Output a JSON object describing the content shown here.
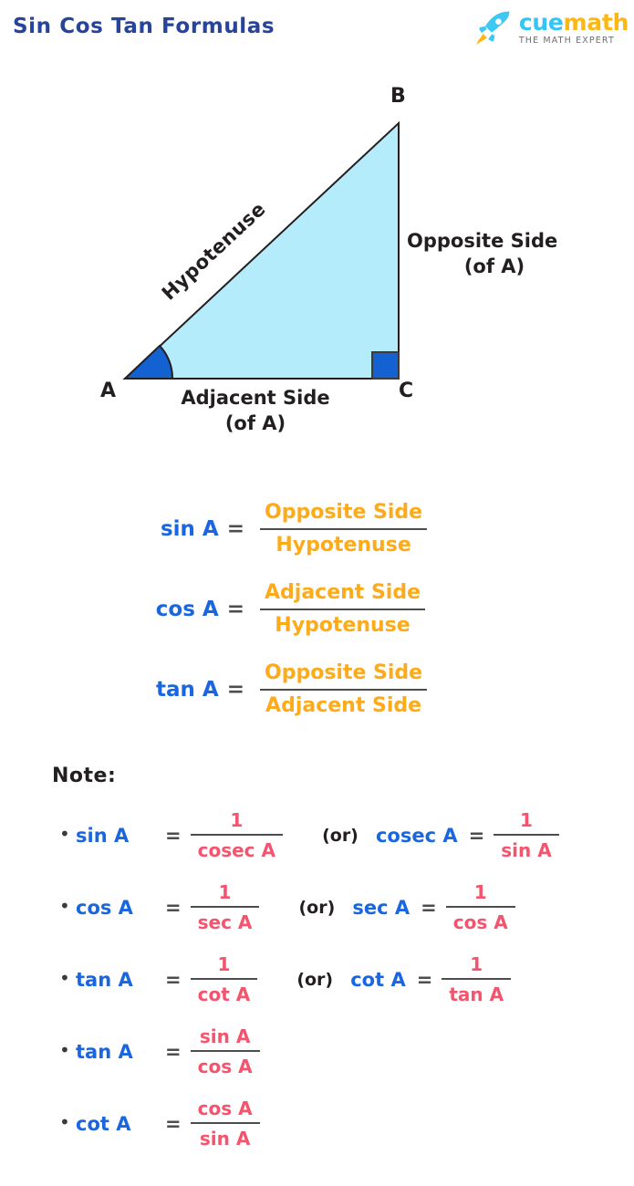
{
  "header": {
    "title": "Sin Cos Tan Formulas",
    "logo": {
      "brand_cue": "cue",
      "brand_math": "math",
      "tagline": "THE MATH EXPERT",
      "icon": "rocket-icon",
      "color_cue": "#33c6f4",
      "color_math": "#fdb714",
      "color_tagline": "#6d6e71"
    },
    "title_color": "#27449a"
  },
  "diagram": {
    "vertices": {
      "a": "A",
      "b": "B",
      "c": "C"
    },
    "hypotenuse_label": "Hypotenuse",
    "opposite_label_line1": "Opposite Side",
    "opposite_label_line2": "(of A)",
    "adjacent_label_line1": "Adjacent Side",
    "adjacent_label_line2": "(of A)",
    "fill_color": "#b5ecfb",
    "stroke_color": "#231f20",
    "angle_marker_color": "#1461d2",
    "right_angle_color": "#1461d2"
  },
  "main_formulas": [
    {
      "lhs": "sin A",
      "eq": "=",
      "numerator": "Opposite Side",
      "denominator": "Hypotenuse"
    },
    {
      "lhs": "cos A",
      "eq": "=",
      "numerator": "Adjacent Side",
      "denominator": "Hypotenuse"
    },
    {
      "lhs": "tan A",
      "eq": "=",
      "numerator": "Opposite Side",
      "denominator": "Adjacent Side"
    }
  ],
  "formula_colors": {
    "lhs": "#1a66e0",
    "fraction": "#fdab1a",
    "equals": "#4d4d4d",
    "note_fraction": "#f4546e"
  },
  "note": {
    "heading": "Note:",
    "rows": [
      {
        "bullet": "•",
        "lhs": "sin A",
        "eq": "=",
        "numerator": "1",
        "denominator": "cosec A",
        "or": "(or)",
        "alt_lhs": "cosec A",
        "alt_eq": "=",
        "alt_numerator": "1",
        "alt_denominator": "sin A"
      },
      {
        "bullet": "•",
        "lhs": "cos A",
        "eq": "=",
        "numerator": "1",
        "denominator": "sec A",
        "or": "(or)",
        "alt_lhs": "sec A",
        "alt_eq": "=",
        "alt_numerator": "1",
        "alt_denominator": "cos A"
      },
      {
        "bullet": "•",
        "lhs": "tan A",
        "eq": "=",
        "numerator": "1",
        "denominator": "cot A",
        "or": "(or)",
        "alt_lhs": "cot A",
        "alt_eq": "=",
        "alt_numerator": "1",
        "alt_denominator": "tan A"
      },
      {
        "bullet": "•",
        "lhs": "tan A",
        "eq": "=",
        "numerator": "sin A",
        "denominator": "cos A",
        "or": "",
        "alt_lhs": "",
        "alt_eq": "",
        "alt_numerator": "",
        "alt_denominator": ""
      },
      {
        "bullet": "•",
        "lhs": "cot A",
        "eq": "=",
        "numerator": "cos A",
        "denominator": "sin A",
        "or": "",
        "alt_lhs": "",
        "alt_eq": "",
        "alt_numerator": "",
        "alt_denominator": ""
      }
    ]
  }
}
